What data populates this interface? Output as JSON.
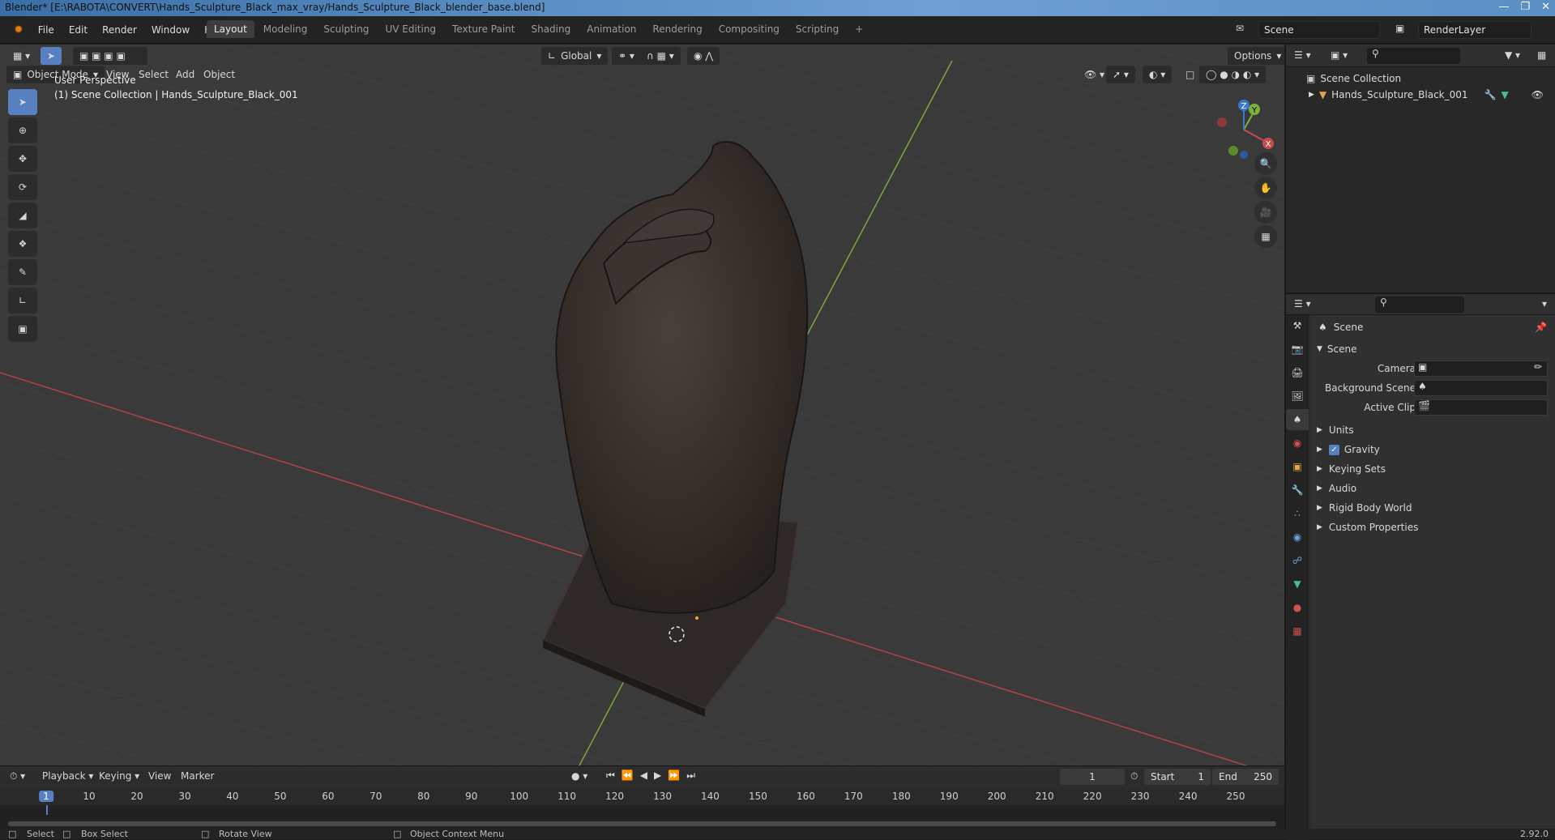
{
  "titlebar": {
    "title": "Blender* [E:\\RABOTA\\CONVERT\\Hands_Sculpture_Black_max_vray/Hands_Sculpture_Black_blender_base.blend]"
  },
  "menu": [
    "File",
    "Edit",
    "Render",
    "Window",
    "Help"
  ],
  "workspaces": [
    {
      "label": "Layout",
      "active": true
    },
    {
      "label": "Modeling"
    },
    {
      "label": "Sculpting"
    },
    {
      "label": "UV Editing"
    },
    {
      "label": "Texture Paint"
    },
    {
      "label": "Shading"
    },
    {
      "label": "Animation"
    },
    {
      "label": "Rendering"
    },
    {
      "label": "Compositing"
    },
    {
      "label": "Scripting"
    }
  ],
  "scene_name": "Scene",
  "view_layer": "RenderLayer",
  "viewport": {
    "transform_orientation": "Global",
    "options_label": "Options",
    "mode": "Object Mode",
    "menus": [
      "View",
      "Select",
      "Add",
      "Object"
    ],
    "overlay_title": "User Perspective",
    "overlay_subtitle": "(1) Scene Collection | Hands_Sculpture_Black_001",
    "gizmo_axes": {
      "x": "X",
      "y": "Y",
      "z": "Z"
    }
  },
  "outliner": {
    "root": "Scene Collection",
    "items": [
      {
        "label": "Hands_Sculpture_Black_001"
      }
    ]
  },
  "properties": {
    "context": "Scene",
    "panel_title": "Scene",
    "fields": [
      {
        "label": "Camera"
      },
      {
        "label": "Background Scene"
      },
      {
        "label": "Active Clip"
      }
    ],
    "sections": [
      {
        "label": "Units",
        "checkbox": false
      },
      {
        "label": "Gravity",
        "checkbox": true
      },
      {
        "label": "Keying Sets",
        "checkbox": false
      },
      {
        "label": "Audio",
        "checkbox": false
      },
      {
        "label": "Rigid Body World",
        "checkbox": false
      },
      {
        "label": "Custom Properties",
        "checkbox": false
      }
    ]
  },
  "timeline": {
    "menus": [
      "Playback",
      "Keying",
      "View",
      "Marker"
    ],
    "current_frame": "1",
    "start_label": "Start",
    "start": "1",
    "end_label": "End",
    "end": "250",
    "ticks": [
      "1",
      "10",
      "20",
      "30",
      "40",
      "50",
      "60",
      "70",
      "80",
      "90",
      "100",
      "110",
      "120",
      "130",
      "140",
      "150",
      "160",
      "170",
      "180",
      "190",
      "200",
      "210",
      "220",
      "230",
      "240",
      "250"
    ]
  },
  "statusbar": {
    "select": "Select",
    "box_select": "Box Select",
    "rotate_view": "Rotate View",
    "context_menu": "Object Context Menu",
    "version": "2.92.0"
  },
  "colors": {
    "accent": "#5680c2",
    "x_axis": "#c84a4a",
    "y_axis": "#7ab23a",
    "z_axis": "#3a7acc"
  }
}
